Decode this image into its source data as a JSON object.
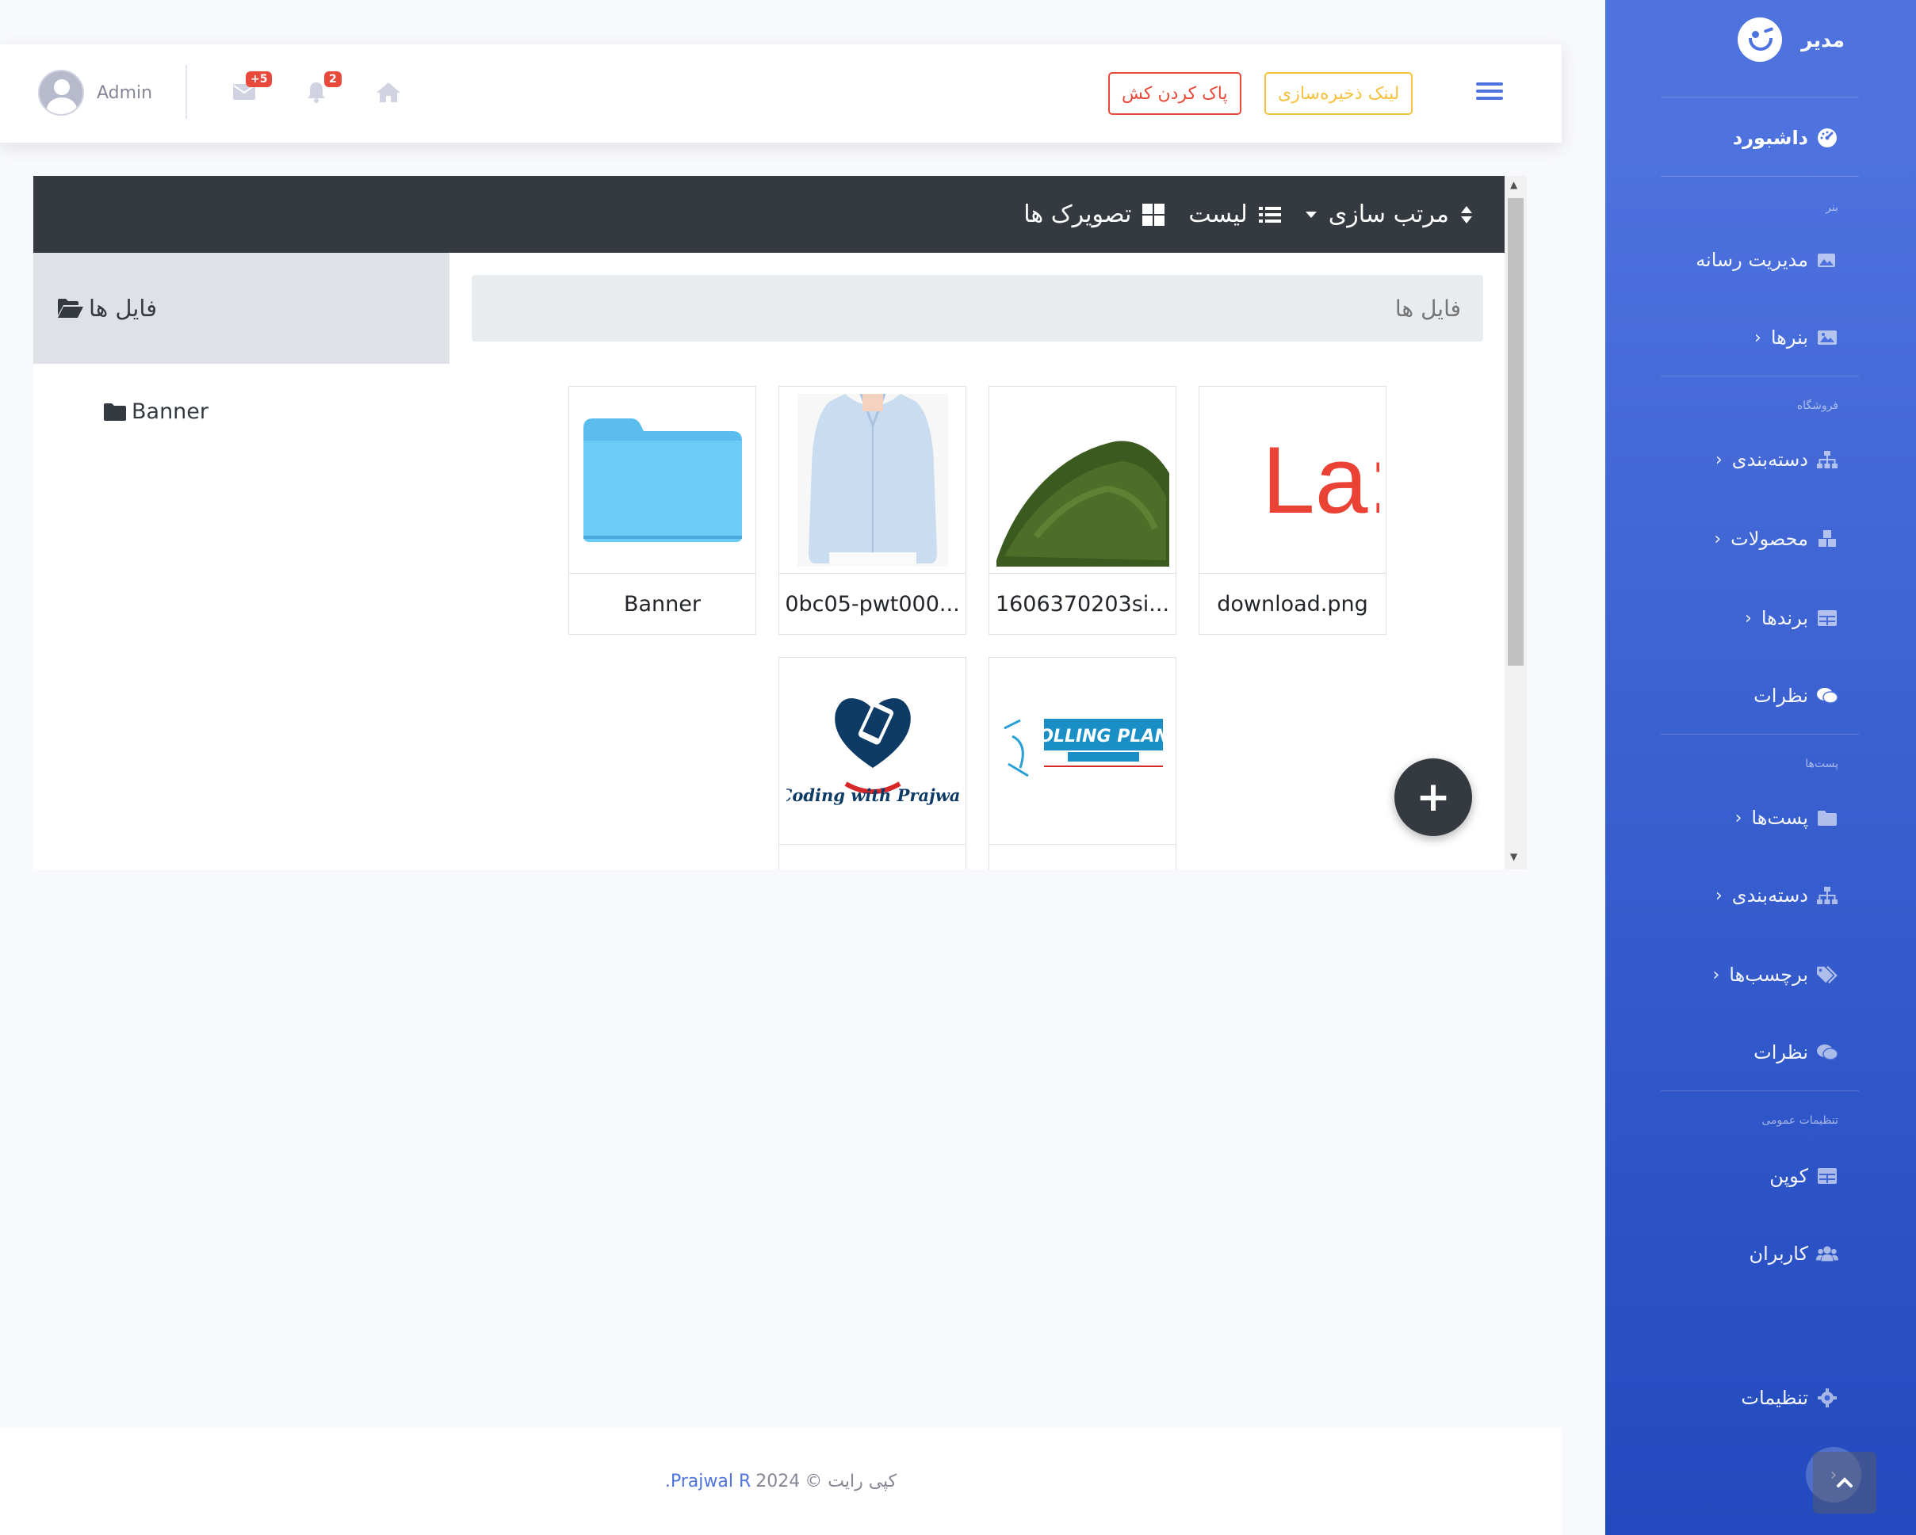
{
  "sidebar": {
    "brand": "مدیر",
    "dashboard": "داشبورد",
    "sections": [
      {
        "heading": "بنر",
        "items": [
          {
            "label": "مدیریت رسانه",
            "icon": "images-icon",
            "caret": false
          },
          {
            "label": "بنرها",
            "icon": "image-icon",
            "caret": true
          }
        ]
      },
      {
        "heading": "فروشگاه",
        "items": [
          {
            "label": "دسته‌بندی",
            "icon": "sitemap-icon",
            "caret": true
          },
          {
            "label": "محصولات",
            "icon": "cubes-icon",
            "caret": true
          },
          {
            "label": "برندها",
            "icon": "table-icon",
            "caret": true
          },
          {
            "label": "نظرات",
            "icon": "comments-icon",
            "caret": false
          }
        ]
      },
      {
        "heading": "پست‌ها",
        "items": [
          {
            "label": "پست‌ها",
            "icon": "folder-icon",
            "caret": true
          },
          {
            "label": "دسته‌بندی",
            "icon": "sitemap-icon",
            "caret": true
          },
          {
            "label": "برچسب‌ها",
            "icon": "tags-icon",
            "caret": true
          },
          {
            "label": "نظرات",
            "icon": "comments-icon",
            "caret": false
          }
        ]
      },
      {
        "heading": "تنظیمات عمومی",
        "items": [
          {
            "label": "کوپن",
            "icon": "table-icon",
            "caret": false
          },
          {
            "label": "کاربران",
            "icon": "users-icon",
            "caret": false
          }
        ]
      }
    ],
    "settings": "تنظیمات"
  },
  "topbar": {
    "user_name": "Admin",
    "messages_badge": "+5",
    "alerts_badge": "2",
    "clear_cache": "پاک کردن کش",
    "storage_link": "لینک ذخیره‌سازی"
  },
  "file_manager": {
    "sort_label": "مرتب سازی",
    "list_label": "لیست",
    "thumbs_label": "تصویرک ها",
    "panel_title": "فایل ها",
    "tree": [
      "Banner"
    ],
    "search_placeholder": "فایل ها",
    "items": [
      {
        "label": "Banner",
        "kind": "folder"
      },
      {
        "label": "0bc05-pwt000...",
        "kind": "shirt"
      },
      {
        "label": "1606370203si...",
        "kind": "powder"
      },
      {
        "label": "download.png",
        "kind": "text-logo"
      },
      {
        "label": "",
        "kind": "coding-logo",
        "logo_text": "Coding with Prajwal"
      },
      {
        "label": "",
        "kind": "rolling-logo",
        "logo_text": "ROLLING PLANS"
      }
    ]
  },
  "footer": {
    "copyright": "کپی رایت ©",
    "year": "2024",
    "author": "Prajwal R."
  },
  "colors": {
    "primary": "#4e73df",
    "danger": "#e74a3b",
    "warning": "#f6c23e",
    "dark": "#343a40"
  }
}
